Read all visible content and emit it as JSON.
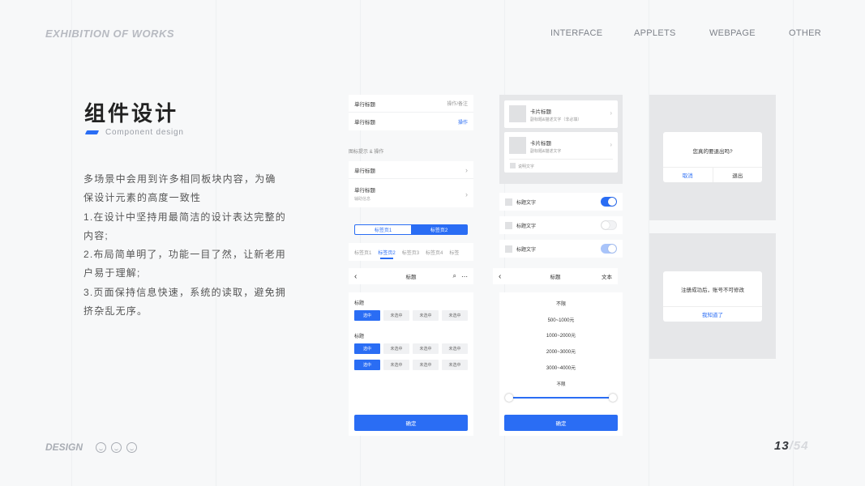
{
  "header": {
    "brand": "EXHIBITION OF WORKS",
    "nav": [
      "INTERFACE",
      "APPLETS",
      "WEBPAGE",
      "OTHER"
    ]
  },
  "intro": {
    "title": "组件设计",
    "subtitle": "Component design",
    "paragraphs": [
      "多场景中会用到许多相同板块内容，为确保设计元素的高度一致性",
      "1.在设计中坚持用最简洁的设计表达完整的内容;",
      "2.布局简单明了，功能一目了然，让新老用户易于理解;",
      "3.页面保持信息快速，系统的读取，避免拥挤杂乱无序。"
    ]
  },
  "footer": {
    "brand": "DESIGN",
    "page_current": "13",
    "page_total": "/54"
  },
  "col1": {
    "rows": [
      {
        "title": "单行标题",
        "right": "操作/备注"
      },
      {
        "title": "单行标题",
        "right": "操作"
      }
    ],
    "section_label": "图标提示 & 操作",
    "rows2": [
      {
        "title": "单行标题"
      },
      {
        "title": "单行标题",
        "sub": "辅助信息"
      }
    ],
    "segment": [
      "标签页1",
      "标签页2"
    ],
    "tabs": [
      "标签页1",
      "标签页2",
      "标签页3",
      "标签页4",
      "标签"
    ],
    "navbar_title": "标题",
    "group1_label": "标题",
    "group2_label": "标题",
    "chip_selected": "选中",
    "chip_unselected": "未选中",
    "confirm": "确定"
  },
  "col2": {
    "cards": [
      {
        "title": "卡片标题",
        "sub": "副标题&描述文字（非必填）"
      },
      {
        "title": "卡片标题",
        "sub": "副标题&描述文字",
        "note": "说明文字"
      }
    ],
    "toggles": [
      {
        "label": "标题文字",
        "state": "on"
      },
      {
        "label": "标题文字",
        "state": "off"
      },
      {
        "label": "标题文字",
        "state": "disabled"
      }
    ],
    "navbar_title": "标题",
    "navbar_right": "文本",
    "prices": [
      "不限",
      "500~1000元",
      "1000~2000元",
      "2000~3000元",
      "3000~4000元"
    ],
    "slider_label": "不限",
    "confirm": "确定"
  },
  "col3": {
    "dialog1": {
      "message": "您真的要退出吗?",
      "cancel": "取消",
      "confirm": "退出"
    },
    "dialog2": {
      "message": "注册成功后，账号不可修改",
      "ok": "我知道了"
    }
  },
  "colors": {
    "accent": "#2a6df4",
    "bg": "#f7f8f9",
    "panel_gray": "#e6e7e9"
  }
}
